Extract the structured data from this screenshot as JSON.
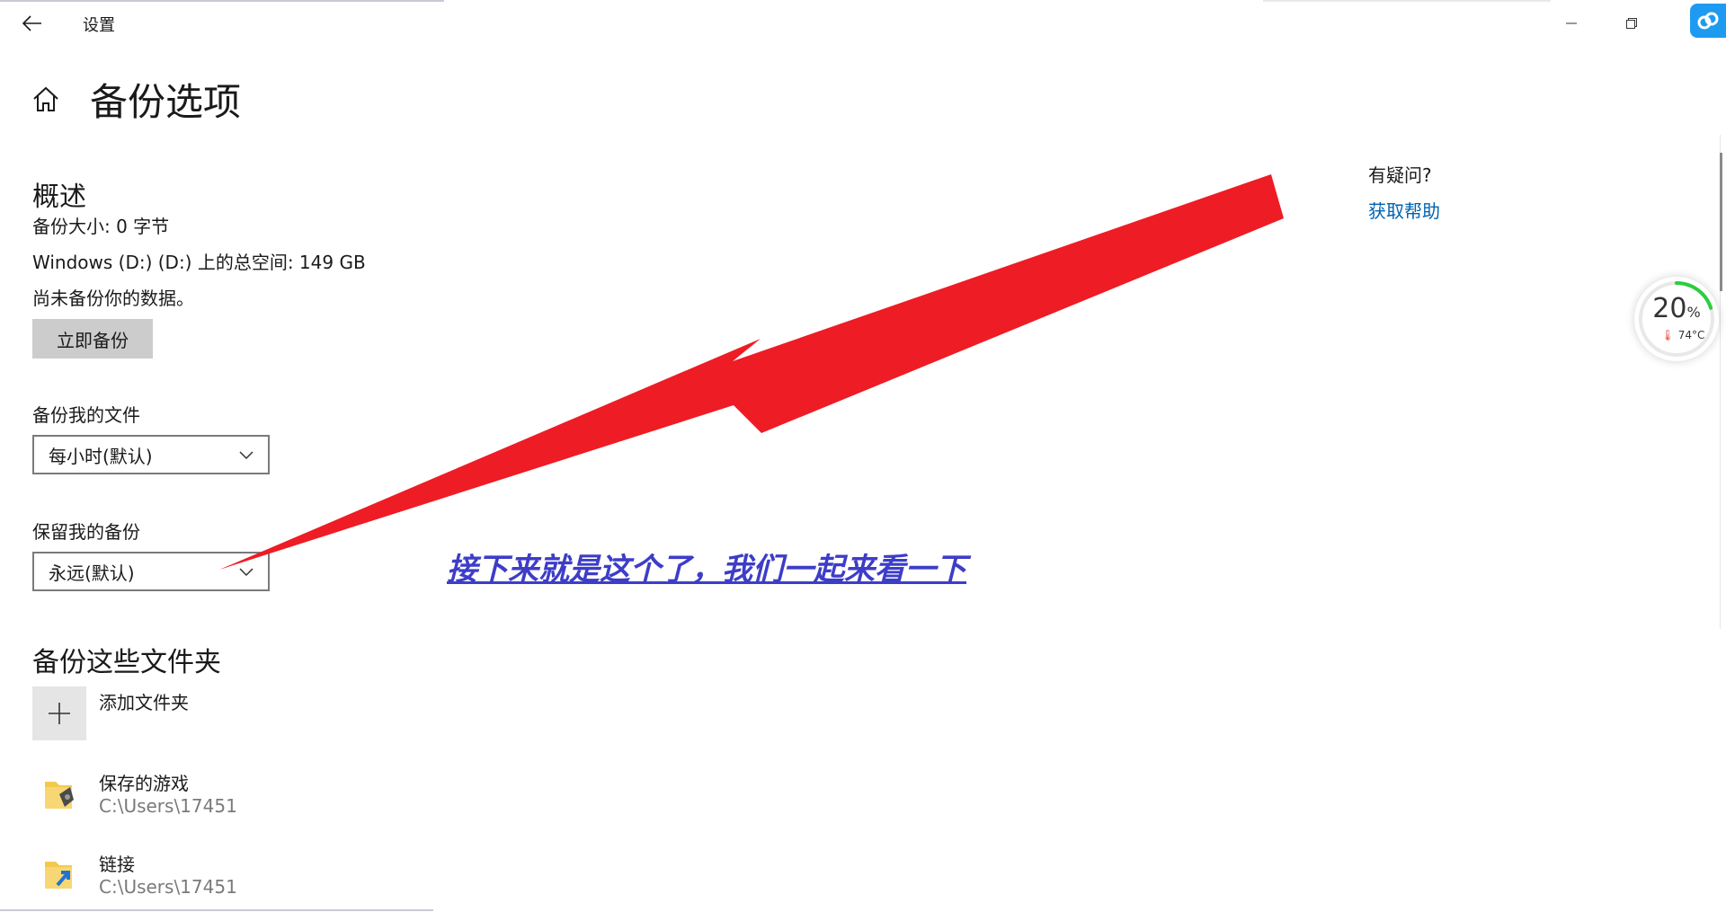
{
  "window": {
    "app_title": "设置",
    "controls": {
      "minimize": "minimize-icon",
      "maximize": "restore-icon",
      "close": "close-icon"
    }
  },
  "page": {
    "title": "备份选项"
  },
  "overview": {
    "title": "概述",
    "backup_size": "备份大小: 0 字节",
    "total_space": "Windows (D:) (D:) 上的总空间: 149 GB",
    "status": "尚未备份你的数据。",
    "backup_now_label": "立即备份"
  },
  "frequency": {
    "label": "备份我的文件",
    "value": "每小时(默认)"
  },
  "retention": {
    "label": "保留我的备份",
    "value": "永远(默认)"
  },
  "folders": {
    "title": "备份这些文件夹",
    "add_label": "添加文件夹",
    "items": [
      {
        "name": "保存的游戏",
        "path": "C:\\Users\\17451",
        "icon": "saved-games-folder-icon"
      },
      {
        "name": "链接",
        "path": "C:\\Users\\17451",
        "icon": "links-folder-icon"
      }
    ]
  },
  "help": {
    "question": "有疑问?",
    "link": "获取帮助"
  },
  "gauge": {
    "percent": "20",
    "unit": "%",
    "temperature": "74°C",
    "level": 0.2,
    "color": "#2ecc40"
  },
  "annotation": {
    "caption": "接下来就是这个了，我们一起来看一下",
    "arrow_color": "#ee1c25",
    "caption_color": "#3d3dc8"
  },
  "colors": {
    "accent": "#0063b1",
    "button_bg": "#cccccc"
  }
}
